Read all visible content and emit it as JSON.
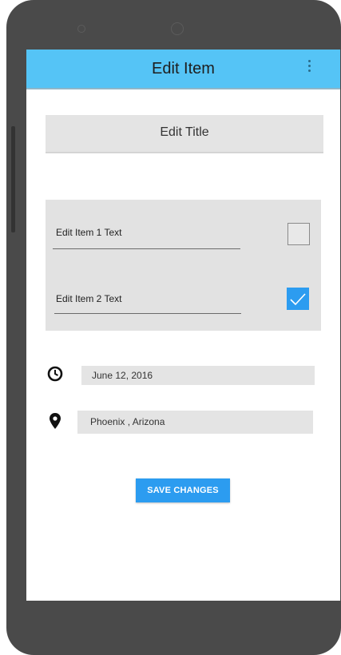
{
  "colors": {
    "appbar": "#55c4f6",
    "accent": "#2c9cf0",
    "field_bg": "#e4e4e4",
    "device": "#4a4a4a"
  },
  "appbar": {
    "title": "Edit Item",
    "menu_icon": "more-vert-icon"
  },
  "form": {
    "title_field": "Edit Title",
    "items": [
      {
        "label": "Edit Item 1 Text",
        "checked": false
      },
      {
        "label": "Edit Item 2 Text",
        "checked": true
      }
    ],
    "date": {
      "icon": "clock-icon",
      "value": "June 12, 2016"
    },
    "location": {
      "icon": "location-pin-icon",
      "value": "Phoenix , Arizona"
    },
    "save_label": "SAVE CHANGES"
  }
}
